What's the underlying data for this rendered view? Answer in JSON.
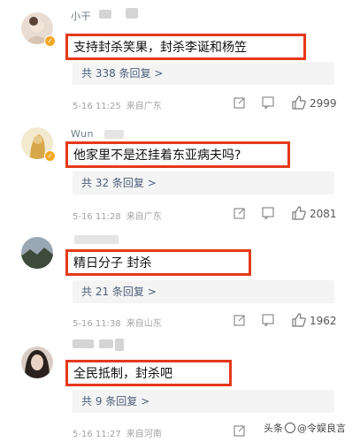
{
  "comments": [
    {
      "username": "小干",
      "text": "支持封杀笑果，封杀李诞和杨笠",
      "replies": "共 338 条回复 >",
      "date": "5-16 11:25",
      "location": "来自广东",
      "likes": "2999"
    },
    {
      "username": "Wun",
      "text": "他家里不是还挂着东亚病夫吗?",
      "replies": "共 32 条回复 >",
      "date": "5-16 11:28",
      "location": "来自广东",
      "likes": "2081"
    },
    {
      "username": "",
      "text": "精日分子  封杀",
      "replies": "共 21 条回复 >",
      "date": "5-16 11:38",
      "location": "来自山东",
      "likes": "1962"
    },
    {
      "username": "",
      "text": "全民抵制，封杀吧",
      "replies": "共 9 条回复 >",
      "date": "5-16 11:27",
      "location": "来自河南",
      "likes": ""
    }
  ],
  "watermark": {
    "prefix": "头条",
    "handle": "@令娱良言"
  },
  "icons": {
    "share": "share-edit-icon",
    "comment": "comment-icon",
    "like": "thumbs-up-icon",
    "verified": "verified-badge-icon"
  },
  "colors": {
    "highlight_border": "#e5391a",
    "reply_link": "#4b5e79",
    "verified": "#f5a623"
  }
}
